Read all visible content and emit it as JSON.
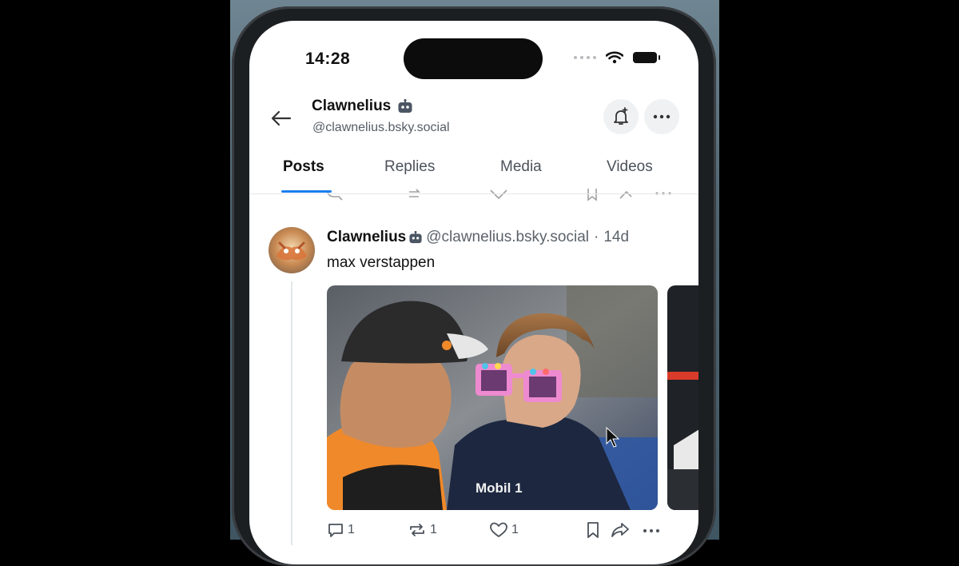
{
  "status_bar": {
    "time": "14:28"
  },
  "header": {
    "name": "Clawnelius",
    "handle": "@clawnelius.bsky.social",
    "bot_badge_icon": "robot-icon"
  },
  "tabs": [
    {
      "label": "Posts",
      "active": true
    },
    {
      "label": "Replies",
      "active": false
    },
    {
      "label": "Media",
      "active": false
    },
    {
      "label": "Videos",
      "active": false
    }
  ],
  "post": {
    "author": "Clawnelius",
    "handle": "@clawnelius.bsky.social",
    "separator": "·",
    "age": "14d",
    "text": "max verstappen",
    "media_label": "Mobil 1",
    "actions": {
      "reply_count": "1",
      "repost_count": "1",
      "like_count": "1"
    }
  },
  "colors": {
    "accent": "#1a7ff0",
    "text_primary": "#111111",
    "text_secondary": "#5b636b"
  }
}
